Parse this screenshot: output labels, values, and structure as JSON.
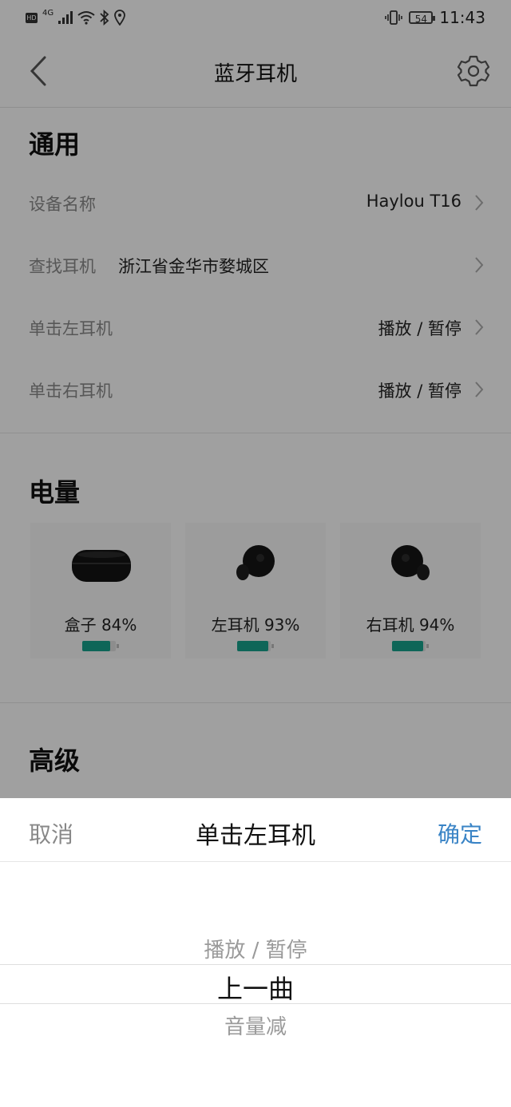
{
  "status_bar": {
    "hd": "HD",
    "network": "4G",
    "battery_level": "54",
    "time": "11:43"
  },
  "header": {
    "title": "蓝牙耳机"
  },
  "general": {
    "heading": "通用",
    "rows": [
      {
        "label": "设备名称",
        "middle": "",
        "value": "Haylou T16"
      },
      {
        "label": "查找耳机",
        "middle": "浙江省金华市婺城区",
        "value": ""
      },
      {
        "label": "单击左耳机",
        "middle": "",
        "value": "播放 / 暂停"
      },
      {
        "label": "单击右耳机",
        "middle": "",
        "value": "播放 / 暂停"
      }
    ]
  },
  "battery": {
    "heading": "电量",
    "items": [
      {
        "label": "盒子 84%",
        "level": 0.84,
        "icon": "case-icon"
      },
      {
        "label": "左耳机 93%",
        "level": 0.93,
        "icon": "left-earbud-icon"
      },
      {
        "label": "右耳机 94%",
        "level": 0.94,
        "icon": "right-earbud-icon"
      }
    ],
    "fill_color": "#16a08a"
  },
  "advanced": {
    "heading": "高级"
  },
  "sheet": {
    "cancel": "取消",
    "title": "单击左耳机",
    "confirm": "确定",
    "confirm_color": "#3a84c6",
    "options": [
      "播放 / 暂停",
      "上一曲",
      "音量减"
    ],
    "selected": "上一曲"
  }
}
